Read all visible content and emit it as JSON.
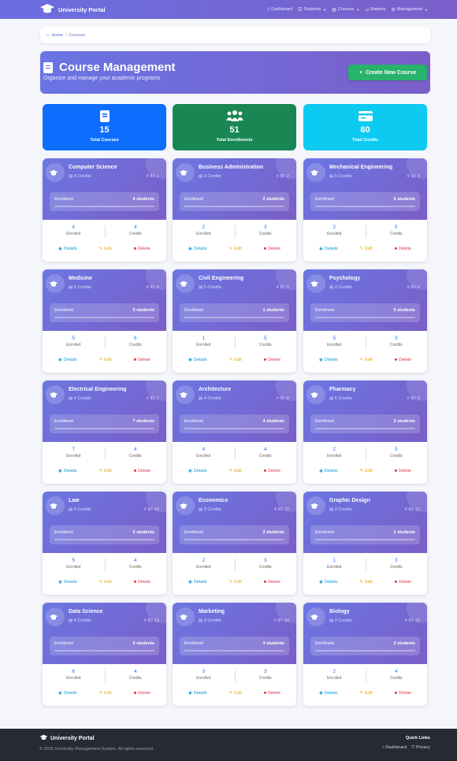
{
  "brand": "University Portal",
  "nav": {
    "dashboard": "Dashboard",
    "students": "Students",
    "courses": "Courses",
    "reports": "Reports",
    "management": "Management"
  },
  "breadcrumb": {
    "home": "Home",
    "current": "Courses"
  },
  "header": {
    "title": "Course Management",
    "subtitle": "Organize and manage your academic programs",
    "create_label": "Create New Course"
  },
  "stats": [
    {
      "value": "15",
      "label": "Total Courses",
      "icon": "book-icon"
    },
    {
      "value": "51",
      "label": "Total Enrollments",
      "icon": "users-icon"
    },
    {
      "value": "60",
      "label": "Total Credits",
      "icon": "credit-card-icon"
    }
  ],
  "labels": {
    "enrollment": "Enrollment",
    "enrolled": "Enrolled",
    "credits": "Credits",
    "details": "Details",
    "edit": "Edit",
    "delete": "Delete"
  },
  "courses": [
    {
      "name": "Computer Science",
      "credits_text": "4 Credits",
      "id_text": "ID: 1",
      "students": "4 students",
      "enrolled": "4",
      "credits": "4"
    },
    {
      "name": "Business Administration",
      "credits_text": "3 Credits",
      "id_text": "ID: 2",
      "students": "2 students",
      "enrolled": "2",
      "credits": "3"
    },
    {
      "name": "Mechanical Engineering",
      "credits_text": "5 Credits",
      "id_text": "ID: 3",
      "students": "2 students",
      "enrolled": "2",
      "credits": "5"
    },
    {
      "name": "Medicine",
      "credits_text": "6 Credits",
      "id_text": "ID: 4",
      "students": "5 students",
      "enrolled": "5",
      "credits": "6"
    },
    {
      "name": "Civil Engineering",
      "credits_text": "5 Credits",
      "id_text": "ID: 5",
      "students": "1 students",
      "enrolled": "1",
      "credits": "5"
    },
    {
      "name": "Psychology",
      "credits_text": "3 Credits",
      "id_text": "ID: 6",
      "students": "5 students",
      "enrolled": "5",
      "credits": "3"
    },
    {
      "name": "Electrical Engineering",
      "credits_text": "4 Credits",
      "id_text": "ID: 7",
      "students": "7 students",
      "enrolled": "7",
      "credits": "4"
    },
    {
      "name": "Architecture",
      "credits_text": "4 Credits",
      "id_text": "ID: 8",
      "students": "4 students",
      "enrolled": "4",
      "credits": "4"
    },
    {
      "name": "Pharmacy",
      "credits_text": "5 Credits",
      "id_text": "ID: 9",
      "students": "2 students",
      "enrolled": "2",
      "credits": "5"
    },
    {
      "name": "Law",
      "credits_text": "4 Credits",
      "id_text": "ID: 10",
      "students": "5 students",
      "enrolled": "5",
      "credits": "4"
    },
    {
      "name": "Economics",
      "credits_text": "3 Credits",
      "id_text": "ID: 11",
      "students": "2 students",
      "enrolled": "2",
      "credits": "3"
    },
    {
      "name": "Graphic Design",
      "credits_text": "3 Credits",
      "id_text": "ID: 12",
      "students": "1 students",
      "enrolled": "1",
      "credits": "3"
    },
    {
      "name": "Data Science",
      "credits_text": "4 Credits",
      "id_text": "ID: 13",
      "students": "6 students",
      "enrolled": "6",
      "credits": "4"
    },
    {
      "name": "Marketing",
      "credits_text": "3 Credits",
      "id_text": "ID: 14",
      "students": "3 students",
      "enrolled": "3",
      "credits": "3"
    },
    {
      "name": "Biology",
      "credits_text": "4 Credits",
      "id_text": "ID: 15",
      "students": "2 students",
      "enrolled": "2",
      "credits": "4"
    }
  ],
  "footer": {
    "brand": "University Portal",
    "copyright": "© 2025 University Management System. All rights reserved.",
    "quick_links": "Quick Links",
    "dashboard": "Dashboard",
    "privacy": "Privacy"
  }
}
